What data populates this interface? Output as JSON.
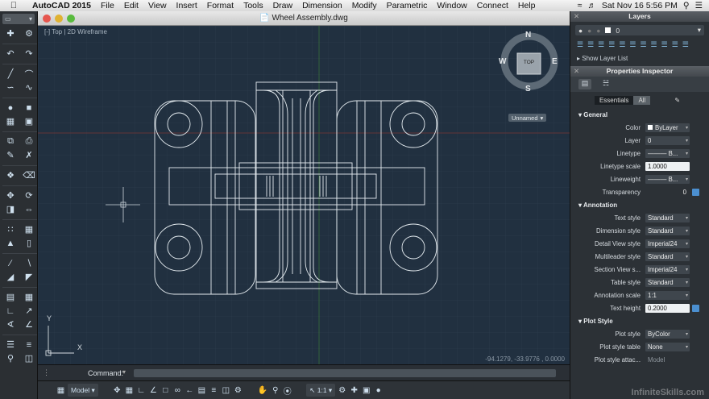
{
  "menubar": {
    "app": "AutoCAD 2015",
    "items": [
      "File",
      "Edit",
      "View",
      "Insert",
      "Format",
      "Tools",
      "Draw",
      "Dimension",
      "Modify",
      "Parametric",
      "Window",
      "Connect",
      "Help"
    ],
    "datetime": "Sat Nov 16  5:56 PM"
  },
  "document": {
    "title": "Wheel Assembly.dwg"
  },
  "viewport": {
    "view": "Top",
    "style": "2D Wireframe"
  },
  "viewcube": {
    "north": "N",
    "south": "S",
    "east": "E",
    "west": "W",
    "face": "TOP"
  },
  "ucs": {
    "name": "Unnamed"
  },
  "coords": "-94.1279, -33.9776 , 0.0000",
  "ucs_axes": {
    "x": "X",
    "y": "Y"
  },
  "command": {
    "label": "Command:"
  },
  "statusbar": {
    "model": "Model",
    "scale": "1:1"
  },
  "layers": {
    "title": "Layers",
    "current": "0",
    "show_list": "Show Layer List"
  },
  "properties": {
    "title": "Properties Inspector",
    "seg": [
      "Essentials",
      "All"
    ],
    "sections": [
      {
        "name": "General",
        "rows": [
          {
            "key": "Color",
            "value": "ByLayer"
          },
          {
            "key": "Layer",
            "value": "0"
          },
          {
            "key": "Linetype",
            "value": "B..."
          },
          {
            "key": "Linetype scale",
            "value": "1.0000",
            "input": true
          },
          {
            "key": "Lineweight",
            "value": "B..."
          },
          {
            "key": "Transparency",
            "value": "0"
          }
        ]
      },
      {
        "name": "Annotation",
        "rows": [
          {
            "key": "Text style",
            "value": "Standard"
          },
          {
            "key": "Dimension style",
            "value": "Standard"
          },
          {
            "key": "Detail View style",
            "value": "Imperial24"
          },
          {
            "key": "Multileader style",
            "value": "Standard"
          },
          {
            "key": "Section View s...",
            "value": "Imperial24"
          },
          {
            "key": "Table style",
            "value": "Standard"
          },
          {
            "key": "Annotation scale",
            "value": "1:1"
          },
          {
            "key": "Text height",
            "value": "0.2000",
            "input": true
          }
        ]
      },
      {
        "name": "Plot Style",
        "rows": [
          {
            "key": "Plot style",
            "value": "ByColor"
          },
          {
            "key": "Plot style table",
            "value": "None"
          },
          {
            "key": "Plot style attac...",
            "value": "Model"
          }
        ]
      }
    ]
  },
  "watermark": "InfiniteSkills.com",
  "colors": {
    "canvas": "#213040",
    "grid": "#2c3d4e",
    "drawing": "#e8eef2",
    "accent": "#4b8fd0"
  }
}
